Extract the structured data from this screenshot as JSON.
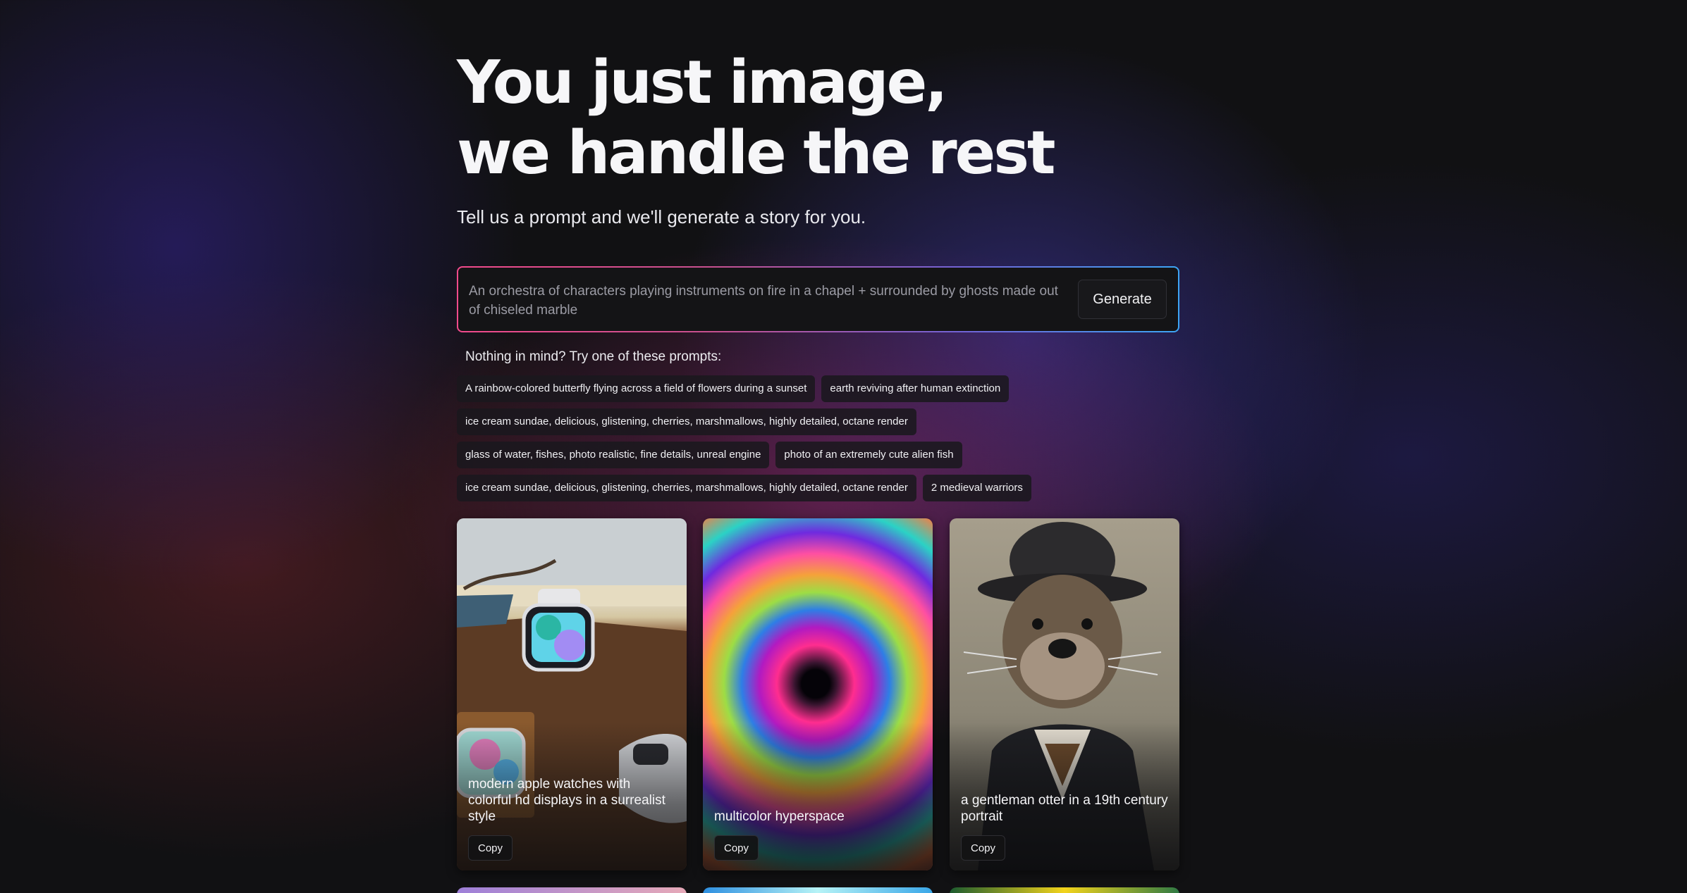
{
  "hero": {
    "title_line1": "You just image,",
    "title_line2": "we handle the rest",
    "subtitle": "Tell us a prompt and we'll generate a story for you."
  },
  "prompt": {
    "value": "An orchestra of characters playing instruments on fire in a chapel + surrounded by ghosts made out of chiseled marble",
    "generate_label": "Generate"
  },
  "suggestions": {
    "heading": "Nothing in mind? Try one of these prompts:",
    "rows": [
      [
        "A rainbow-colored butterfly flying across a field of flowers during a sunset",
        "earth reviving after human extinction"
      ],
      [
        "ice cream sundae, delicious, glistening, cherries, marshmallows, highly detailed, octane render"
      ],
      [
        "glass of water, fishes, photo realistic, fine details, unreal engine",
        "photo of an extremely cute alien fish"
      ],
      [
        "ice cream sundae, delicious, glistening, cherries, marshmallows, highly detailed, octane render",
        "2 medieval warriors"
      ]
    ]
  },
  "gallery": {
    "cards": [
      {
        "caption": "modern apple watches with colorful hd displays in a surrealist style",
        "copy_label": "Copy"
      },
      {
        "caption": "multicolor hyperspace",
        "copy_label": "Copy"
      },
      {
        "caption": "a gentleman otter in a 19th century portrait",
        "copy_label": "Copy"
      }
    ]
  }
}
